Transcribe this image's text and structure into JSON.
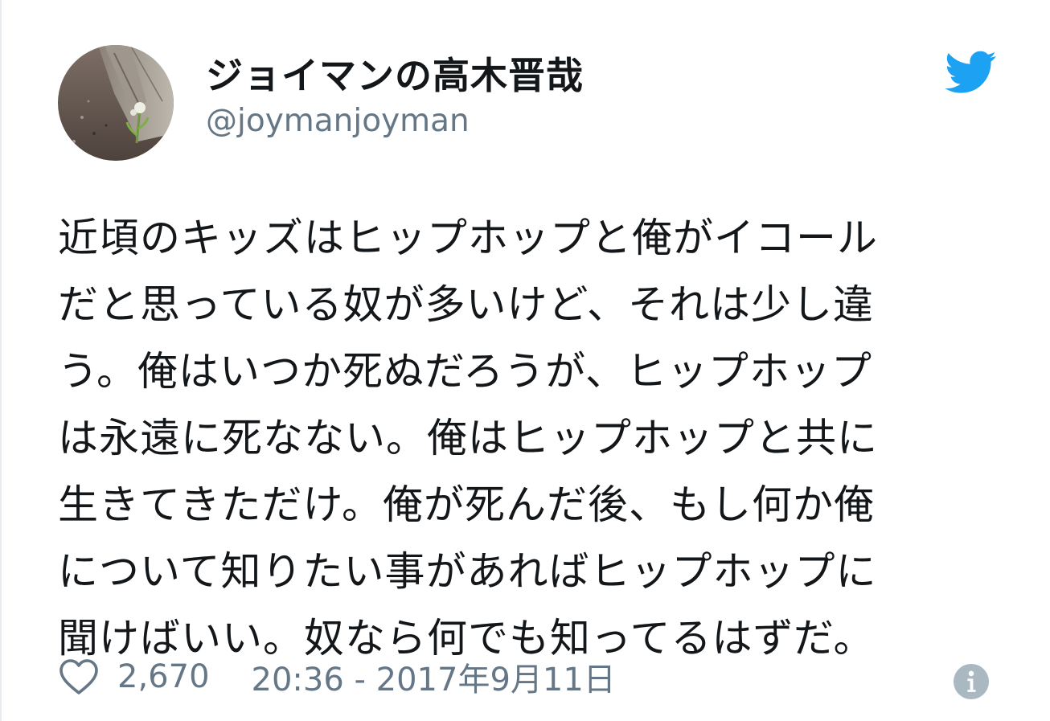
{
  "author": {
    "display_name": "ジョイマンの高木晋哉",
    "handle": "@joymanjoyman"
  },
  "tweet": {
    "lines": [
      "近頃のキッズはヒップホップと俺がイコール",
      "だと思っている奴が多いけど、それは少し違",
      "う。俺はいつか死ぬだろうが、ヒップホップ",
      "は永遠に死なない。俺はヒップホップと共に",
      "生きてきただけ。俺が死んだ後、もし何か俺",
      "について知りたい事があればヒップホップに",
      "聞けばいい。奴なら何でも知ってるはずだ。"
    ]
  },
  "footer": {
    "likes": "2,670",
    "timestamp": "20:36 - 2017年9月11日"
  },
  "icons": {
    "logo": "twitter-bird-icon",
    "like": "heart-icon",
    "info": "info-icon"
  },
  "colors": {
    "twitter_blue": "#1da1f2",
    "text": "#14171a",
    "secondary": "#657786",
    "info_gray": "#aab8c2"
  }
}
